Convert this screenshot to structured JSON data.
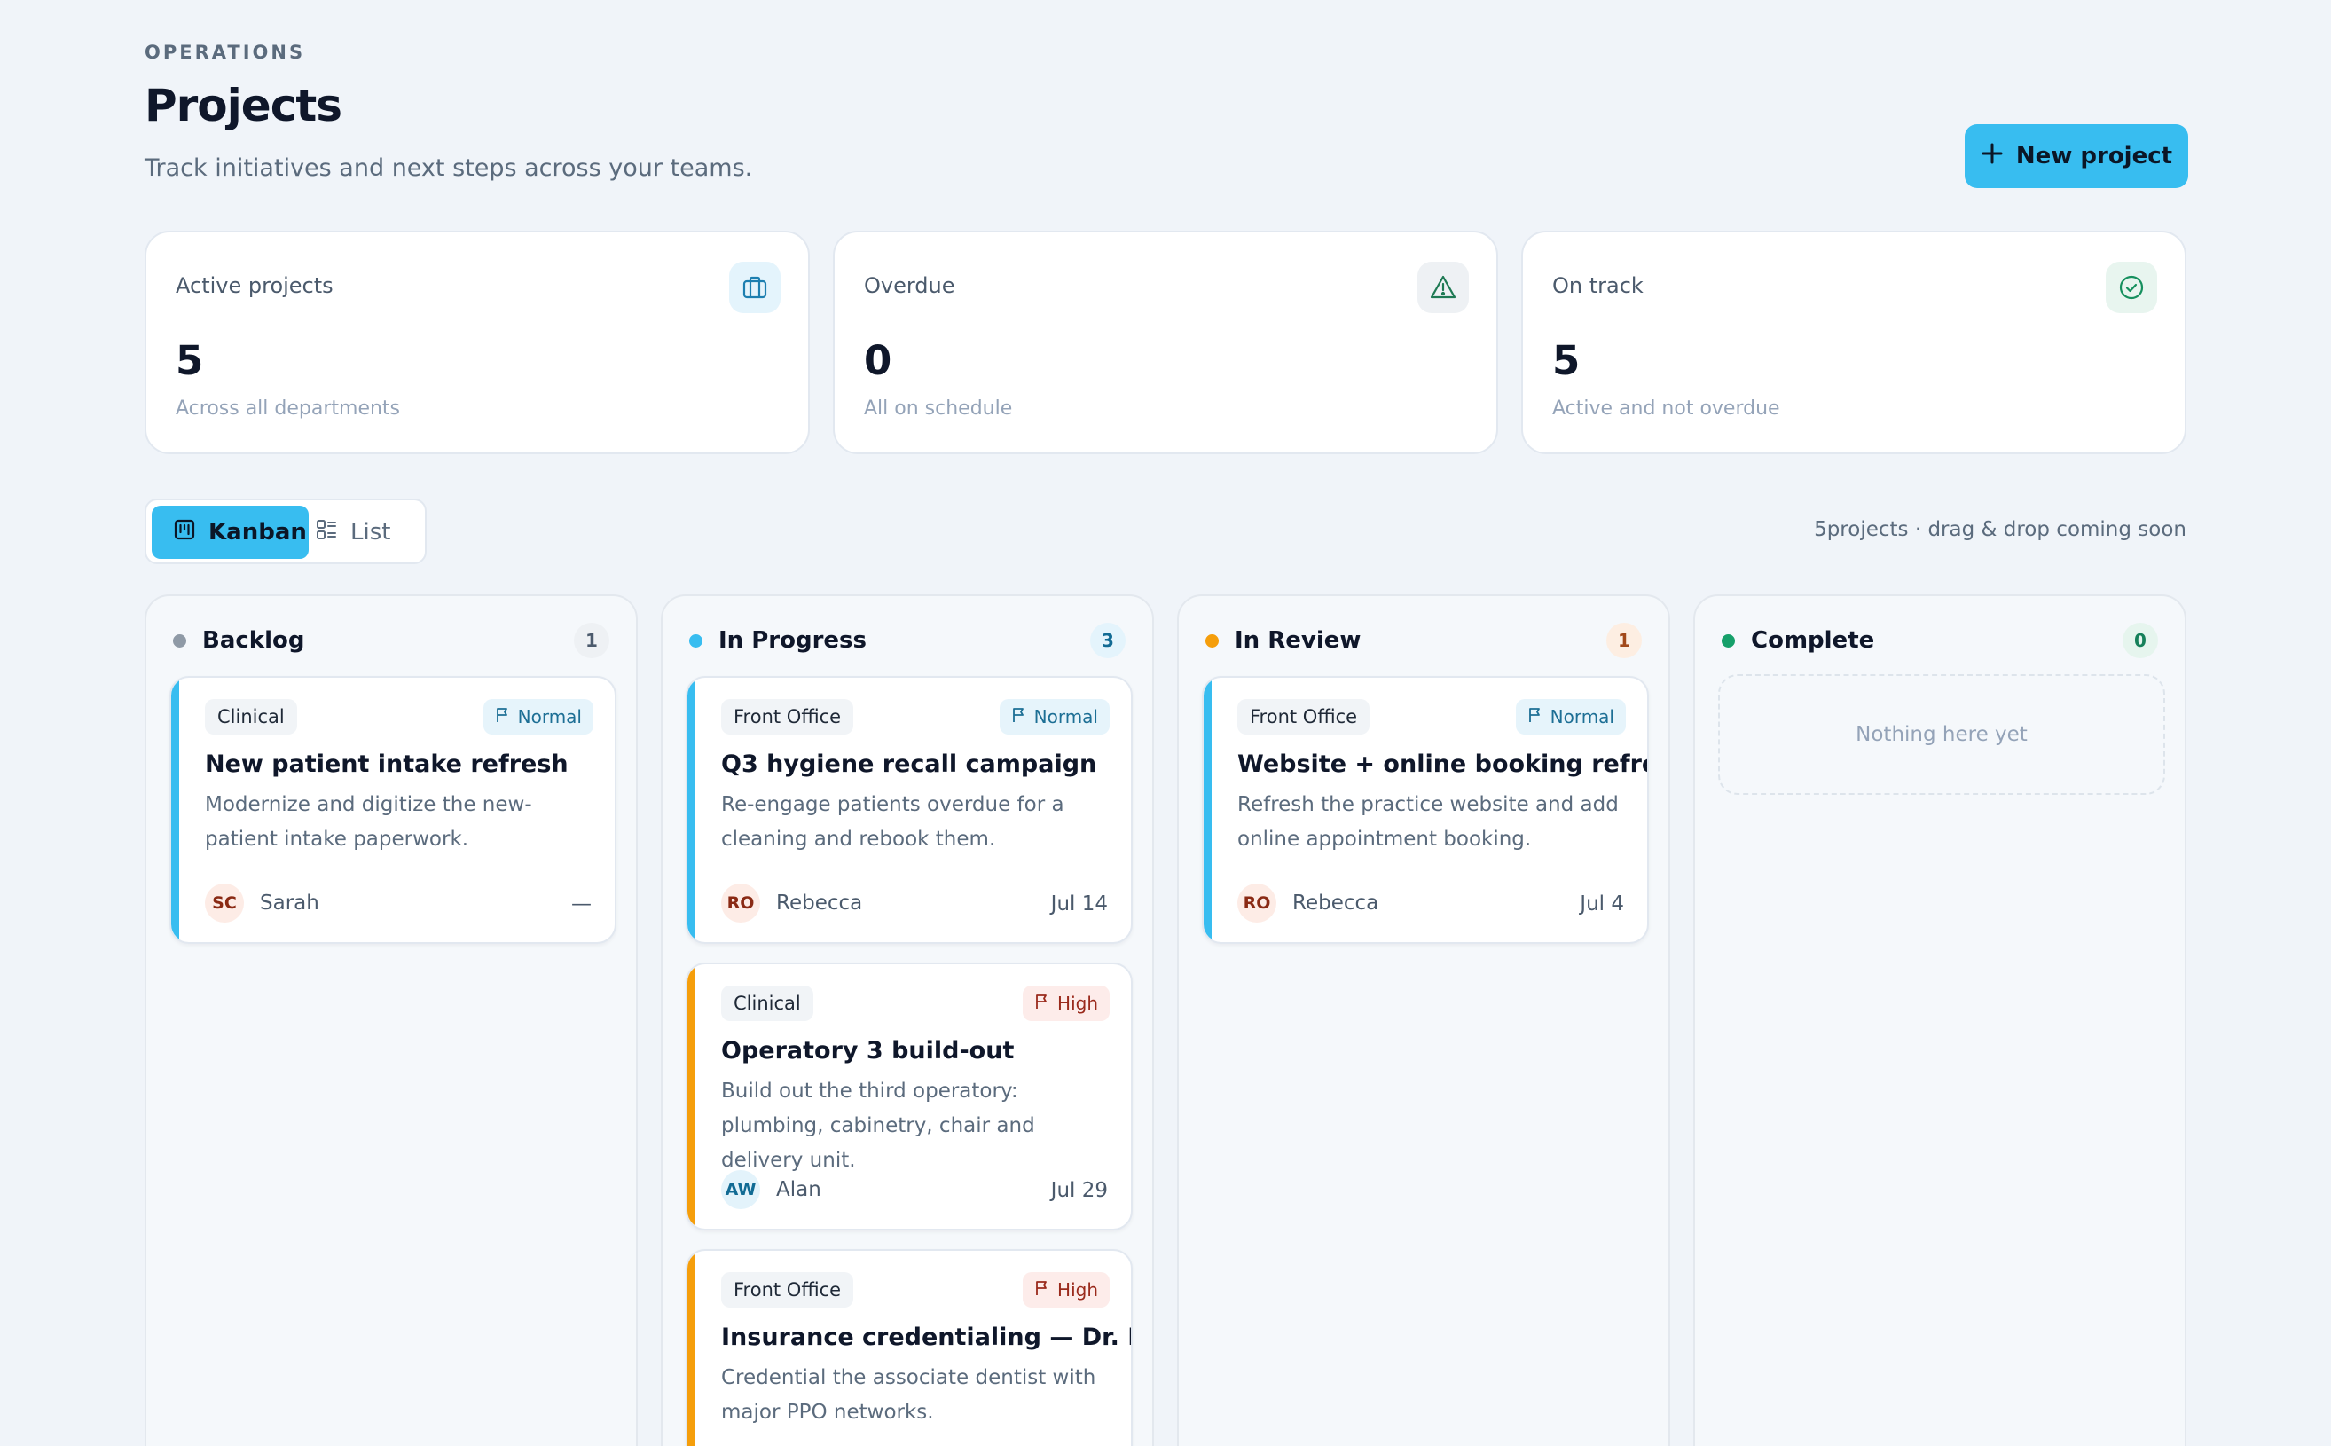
{
  "header": {
    "eyebrow": "OPERATIONS",
    "title": "Projects",
    "subtitle": "Track initiatives and next steps across your teams.",
    "new_button_label": "New project"
  },
  "stats": [
    {
      "label": "Active projects",
      "value": "5",
      "sub": "Across all departments",
      "icon": "briefcase-icon"
    },
    {
      "label": "Overdue",
      "value": "0",
      "sub": "All on schedule",
      "icon": "warning-icon"
    },
    {
      "label": "On track",
      "value": "5",
      "sub": "Active and not overdue",
      "icon": "check-circle-icon"
    }
  ],
  "view_toggle": {
    "kanban_label": "Kanban",
    "list_label": "List",
    "selected": "Kanban"
  },
  "board_note": "5projects · drag & drop coming soon",
  "columns": [
    {
      "title": "Backlog",
      "count": "1",
      "dot_color": "#8f9aa6",
      "cards": [
        {
          "dept": "Clinical",
          "priority": "Normal",
          "title": "New patient intake refresh",
          "desc": "Modernize and digitize the new-patient intake paperwork.",
          "initials": "SC",
          "owner": "Sarah",
          "due": "—",
          "accent": "#38bdf0"
        }
      ]
    },
    {
      "title": "In Progress",
      "count": "3",
      "dot_color": "#38bdf0",
      "cards": [
        {
          "dept": "Front Office",
          "priority": "Normal",
          "title": "Q3 hygiene recall campaign",
          "desc": "Re-engage patients overdue for a cleaning and rebook them.",
          "initials": "RO",
          "owner": "Rebecca",
          "due": "Jul 14",
          "accent": "#38bdf0"
        },
        {
          "dept": "Clinical",
          "priority": "High",
          "title": "Operatory 3 build-out",
          "desc": "Build out the third operatory: plumbing, cabinetry, chair and delivery unit.",
          "initials": "AW",
          "owner": "Alan",
          "due": "Jul 29",
          "accent": "#f59e0b"
        },
        {
          "dept": "Front Office",
          "priority": "High",
          "title": "Insurance credentialing — Dr. Nair",
          "desc": "Credential the associate dentist with major PPO networks.",
          "accent": "#f59e0b"
        }
      ]
    },
    {
      "title": "In Review",
      "count": "1",
      "dot_color": "#f59e0b",
      "cards": [
        {
          "dept": "Front Office",
          "priority": "Normal",
          "title": "Website + online booking refresh",
          "desc": "Refresh the practice website and add online appointment booking.",
          "initials": "RO",
          "owner": "Rebecca",
          "due": "Jul 4",
          "accent": "#38bdf0"
        }
      ]
    },
    {
      "title": "Complete",
      "count": "0",
      "dot_color": "#16a06a",
      "empty_text": "Nothing here yet"
    }
  ]
}
